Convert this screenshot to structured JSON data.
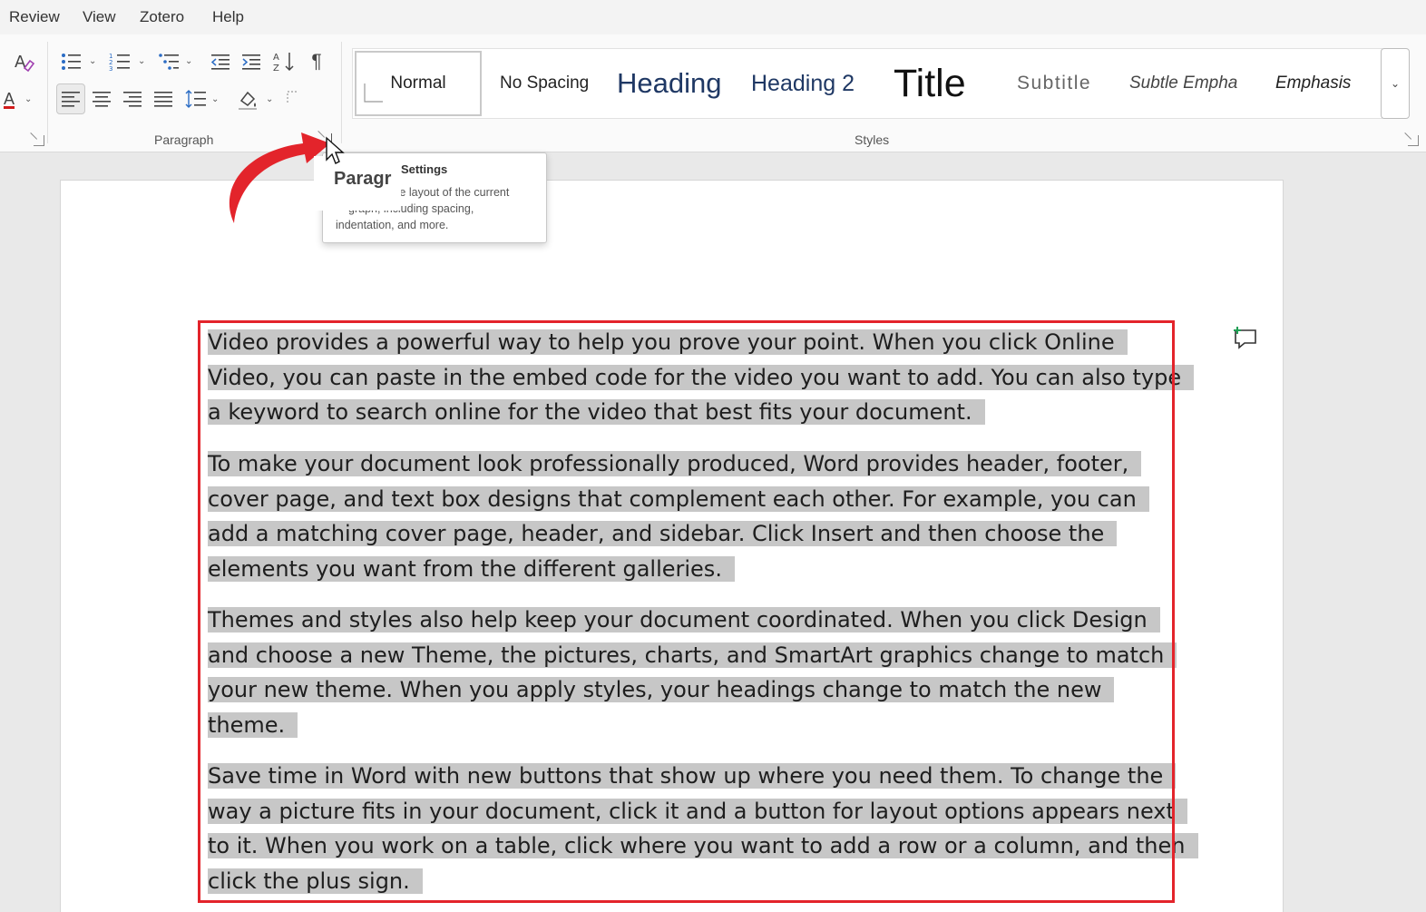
{
  "menu": {
    "items": [
      "Review",
      "View",
      "Zotero",
      "Help"
    ]
  },
  "ribbon": {
    "paragraph_group_label": "Paragraph",
    "styles_group_label": "Styles",
    "styles": [
      "Normal",
      "No Spacing",
      "Heading",
      "Heading 2",
      "Title",
      "Subtitle",
      "Subtle Empha",
      "Emphasis"
    ],
    "selected_style": "Normal",
    "font_color_glyph": "A",
    "show_marks_glyph": "¶",
    "colors": {
      "accent_red": "#e3242b",
      "heading_blue": "#1f3864",
      "font_color_bar": "#d11b1b"
    }
  },
  "tooltip": {
    "title": "Settings",
    "zoom_title": "Paragr",
    "desc_line1": "the layout of the current",
    "desc_line2": "graph, including spacing,",
    "desc_line3": "indentation, and more."
  },
  "document": {
    "paragraphs": [
      [
        "Video provides a powerful way to help you prove your point. When you click Online",
        "Video, you can paste in the embed code for the video you want to add. You can also type",
        "a keyword to search online for the video that best fits your document."
      ],
      [
        "To make your document look professionally produced, Word provides header, footer,",
        "cover page, and text box designs that complement each other. For example, you can",
        "add a matching cover page, header, and sidebar. Click Insert and then choose the",
        "elements you want from the different galleries."
      ],
      [
        "Themes and styles also help keep your document coordinated. When you click Design",
        "and choose a new Theme, the pictures, charts, and SmartArt graphics change to match",
        "your new theme. When you apply styles, your headings change to match the new",
        "theme."
      ],
      [
        "Save time in Word with new buttons that show up where you need them. To change the",
        "way a picture fits in your document, click it and a button for layout options appears next",
        "to it. When you work on a table, click where you want to add a row or a column, and then",
        "click the plus sign."
      ]
    ]
  }
}
